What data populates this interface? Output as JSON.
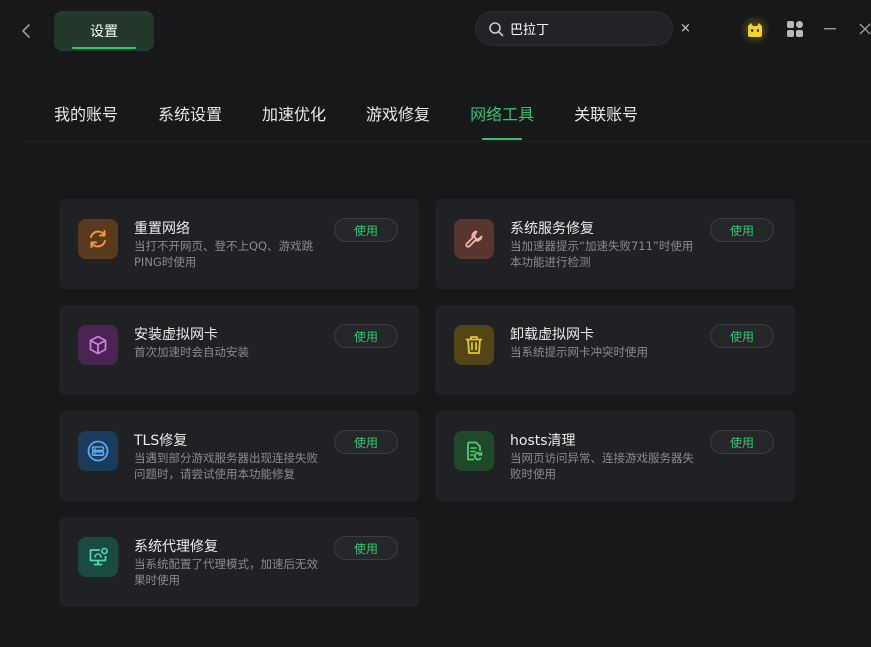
{
  "header": {
    "settings_label": "设置",
    "search_value": "巴拉丁",
    "clear_glyph": "×"
  },
  "tabs": [
    {
      "label": "我的账号",
      "active": false
    },
    {
      "label": "系统设置",
      "active": false
    },
    {
      "label": "加速优化",
      "active": false
    },
    {
      "label": "游戏修复",
      "active": false
    },
    {
      "label": "网络工具",
      "active": true
    },
    {
      "label": "关联账号",
      "active": false
    }
  ],
  "accent_color": "#33c570",
  "tools": [
    {
      "title": "重置网络",
      "desc": "当打不开网页、登不上QQ、游戏跳PING时使用",
      "button": "使用",
      "icon": "refresh-icon",
      "icon_color": "#f09a3e",
      "icon_bg": "#5a3a1e"
    },
    {
      "title": "系统服务修复",
      "desc": "当加速器提示“加速失败711”时使用本功能进行检测",
      "button": "使用",
      "icon": "wrench-icon",
      "icon_color": "#f2b5aa",
      "icon_bg": "#5a3530"
    },
    {
      "title": "安装虚拟网卡",
      "desc": "首次加速时会自动安装",
      "button": "使用",
      "icon": "cube-icon",
      "icon_color": "#d07ae6",
      "icon_bg": "#4a2552"
    },
    {
      "title": "卸载虚拟网卡",
      "desc": "当系统提示网卡冲突时使用",
      "button": "使用",
      "icon": "trash-icon",
      "icon_color": "#e8c430",
      "icon_bg": "#524516"
    },
    {
      "title": "TLS修复",
      "desc": "当遇到部分游戏服务器出现连接失败问题时，请尝试使用本功能修复",
      "button": "使用",
      "icon": "server-icon",
      "icon_color": "#5aa8f0",
      "icon_bg": "#1c3a5a"
    },
    {
      "title": "hosts清理",
      "desc": "当网页访问异常、连接游戏服务器失败时使用",
      "button": "使用",
      "icon": "file-clean-icon",
      "icon_color": "#4ed06a",
      "icon_bg": "#1f4a2a"
    },
    {
      "title": "系统代理修复",
      "desc": "当系统配置了代理模式，加速后无效果时使用",
      "button": "使用",
      "icon": "monitor-icon",
      "icon_color": "#4ed6b8",
      "icon_bg": "#1a4a40"
    }
  ]
}
